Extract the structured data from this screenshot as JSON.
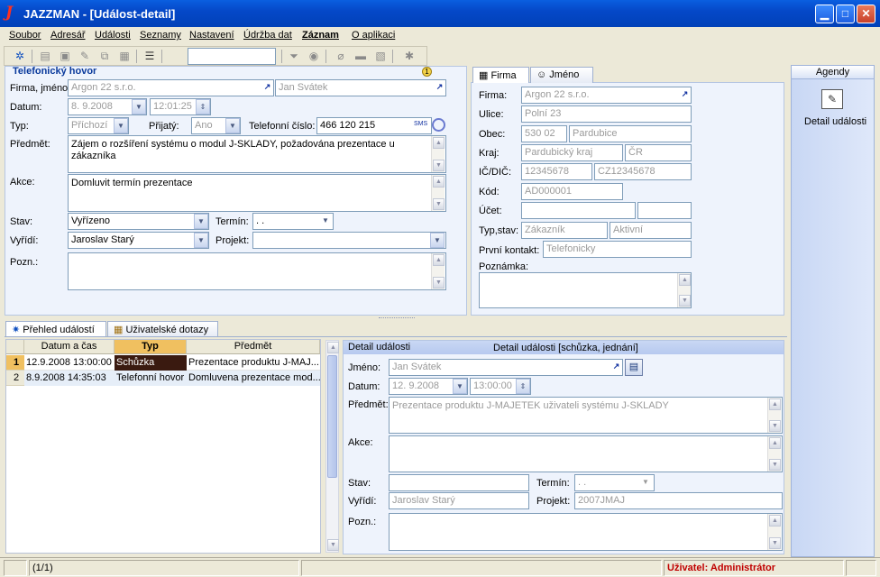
{
  "window": {
    "title": "JAZZMAN - [Událost-detail]",
    "min": "▁",
    "max": "□",
    "close": "✕"
  },
  "menu": [
    "Soubor",
    "Adresář",
    "Události",
    "Seznamy",
    "Nastavení",
    "Údržba dat",
    "Záznam",
    "O aplikaci"
  ],
  "call_panel": {
    "title": "Telefonický hovor",
    "firma_label": "Firma, jméno:",
    "firma": "Argon 22 s.r.o.",
    "jmeno": "Jan Svátek",
    "datum_label": "Datum:",
    "datum": "8. 9.2008",
    "cas": "12:01:25",
    "typ_label": "Typ:",
    "typ": "Příchozí",
    "prijaty_label": "Přijatý:",
    "prijaty": "Ano",
    "tel_label": "Telefonní číslo:",
    "tel": "466 120 215",
    "sms": "SMS",
    "predmet_label": "Předmět:",
    "predmet": "Zájem o rozšíření systému o modul J-SKLADY, požadována prezentace u zákazníka",
    "akce_label": "Akce:",
    "akce": "Domluvit termín prezentace",
    "stav_label": "Stav:",
    "stav": "Vyřízeno",
    "termin_label": "Termín:",
    "termin": " .  .",
    "vyridi_label": "Vyřídí:",
    "vyridi": "Jaroslav Starý",
    "projekt_label": "Projekt:",
    "projekt": "",
    "pozn_label": "Pozn.:",
    "pozn": ""
  },
  "firm_panel": {
    "tab_firma": "Firma",
    "tab_jmeno": "Jméno",
    "firma_label": "Firma:",
    "firma": "Argon 22 s.r.o.",
    "ulice_label": "Ulice:",
    "ulice": "Polní 23",
    "obec_label": "Obec:",
    "psc": "530 02",
    "obec": "Pardubice",
    "kraj_label": "Kraj:",
    "kraj": "Pardubický kraj",
    "stat": "ČR",
    "ic_label": "IČ/DIČ:",
    "ic": "12345678",
    "dic": "CZ12345678",
    "kod_label": "Kód:",
    "kod": "AD000001",
    "ucet_label": "Účet:",
    "ucet": "",
    "ucet2": "",
    "typ_label": "Typ,stav:",
    "typ": "Zákazník",
    "stav": "Aktivní",
    "kontakt_label": "První kontakt:",
    "kontakt": "Telefonicky",
    "poznamka_label": "Poznámka:",
    "poznamka": ""
  },
  "agendy": {
    "title": "Agendy",
    "item": "Detail události"
  },
  "bottom_tabs": [
    "Přehled událostí",
    "Uživatelské dotazy"
  ],
  "table": {
    "headers": [
      "Datum a čas",
      "Typ",
      "Předmět"
    ],
    "rows": [
      {
        "n": "1",
        "datum": "12.9.2008 13:00:00",
        "typ": "Schůzka",
        "predmet": "Prezentace produktu J-MAJ..."
      },
      {
        "n": "2",
        "datum": "8.9.2008 14:35:03",
        "typ": "Telefonní hovor",
        "predmet": "Domluvena prezentace mod..."
      }
    ]
  },
  "detail": {
    "title_left": "Detail události",
    "title_right": "Detail události [schůzka, jednání]",
    "jmeno_label": "Jméno:",
    "jmeno": "Jan Svátek",
    "datum_label": "Datum:",
    "datum": "12. 9.2008",
    "cas": "13:00:00",
    "predmet_label": "Předmět:",
    "predmet": "Prezentace produktu J-MAJETEK uživateli systému J-SKLADY",
    "akce_label": "Akce:",
    "akce": "",
    "stav_label": "Stav:",
    "stav": "",
    "termin_label": "Termín:",
    "termin": " .  .",
    "vyridi_label": "Vyřídí:",
    "vyridi": "Jaroslav Starý",
    "projekt_label": "Projekt:",
    "projekt": "2007JMAJ",
    "pozn_label": "Pozn.:",
    "pozn": ""
  },
  "status": {
    "records": "(1/1)",
    "user": "Uživatel: Administrátor"
  },
  "colors": {
    "titlebar": "#0548c8",
    "panel_bg": "#eef3fc",
    "accent": "#0a3a9c",
    "user_red": "#c00000",
    "typ_header": "#f0c060",
    "selected_row": "#3a1a10"
  }
}
